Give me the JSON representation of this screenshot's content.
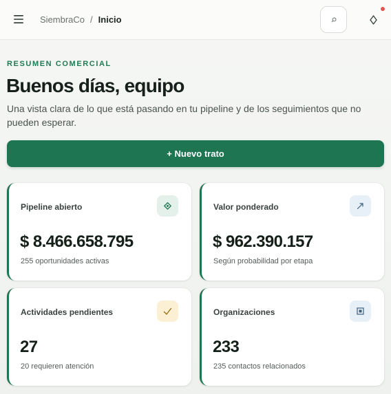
{
  "header": {
    "breadcrumb": {
      "root": "SiembraCo",
      "separator": "/",
      "current": "Inicio"
    },
    "search_icon": "search-icon",
    "notification_icon": "diamond-icon",
    "notification_dot_color": "#e0554f"
  },
  "hero": {
    "eyebrow": "RESUMEN COMERCIAL",
    "title": "Buenos días, equipo",
    "subtitle": "Una vista clara de lo que está pasando en tu pipeline y de los seguimientos que no pueden esperar."
  },
  "actions": {
    "new_deal": "+ Nuevo trato"
  },
  "stats": [
    {
      "label": "Pipeline abierto",
      "value": "$ 8.466.658.795",
      "note": "255 oportunidades activas",
      "icon": "diamond-icon",
      "icon_bg": "#e4f1ea",
      "icon_color": "#1d7551"
    },
    {
      "label": "Valor ponderado",
      "value": "$ 962.390.157",
      "note": "Según probabilidad por etapa",
      "icon": "trend-up-icon",
      "icon_bg": "#e8f0f7",
      "icon_color": "#3a5f80"
    },
    {
      "label": "Actividades pendientes",
      "value": "27",
      "note": "20 requieren atención",
      "icon": "check-icon",
      "icon_bg": "#fbf0d3",
      "icon_color": "#9a6a10"
    },
    {
      "label": "Organizaciones",
      "value": "233",
      "note": "235 contactos relacionados",
      "icon": "building-icon",
      "icon_bg": "#e8f0f7",
      "icon_color": "#3a5f80"
    }
  ],
  "colors": {
    "accent": "#1d7551",
    "eyebrow": "#1f7a55"
  }
}
